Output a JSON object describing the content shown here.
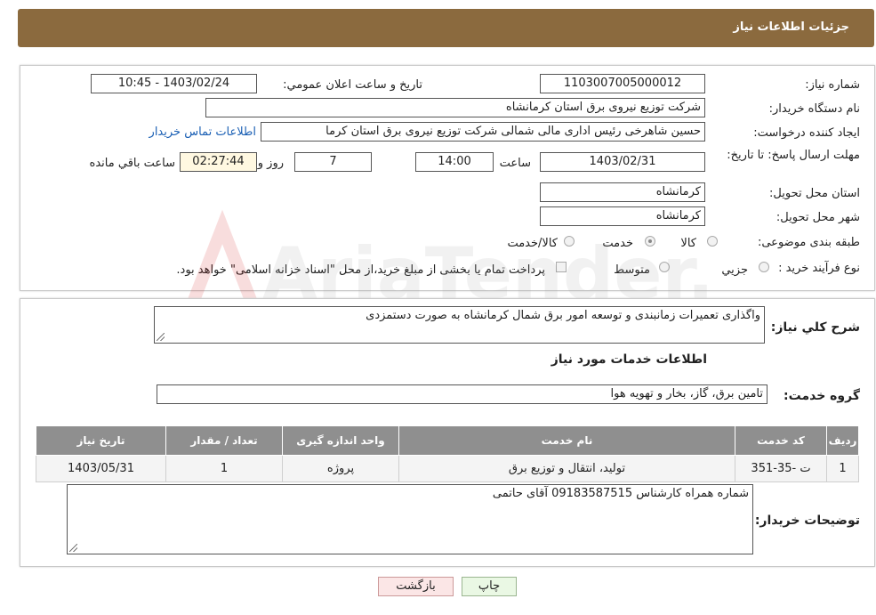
{
  "header": {
    "title": "جزئیات اطلاعات نیاز"
  },
  "form": {
    "need_number": {
      "label": "شماره نیاز:",
      "value": "1103007005000012"
    },
    "announce_datetime": {
      "label": "تاریخ و ساعت اعلان عمومي:",
      "value": "1403/02/24 - 10:45"
    },
    "buyer_org": {
      "label": "نام دستگاه خريدار:",
      "value": "شرکت توزیع نیروی برق استان کرمانشاه"
    },
    "requester": {
      "label": "ايجاد کننده درخواست:",
      "value": "حسین شاهرخی رئیس اداری مالی شمالی شرکت توزیع نیروی برق استان کرما",
      "contact_link": "اطلاعات تماس خريدار"
    },
    "deadline": {
      "label": "مهلت ارسال پاسخ: تا تاريخ:",
      "date": "1403/02/31",
      "time_label": "ساعت",
      "time": "14:00",
      "days": "7",
      "days_label": "روز و",
      "remaining": "02:27:44",
      "remaining_label": "ساعت باقي مانده"
    },
    "delivery_province": {
      "label": "استان محل تحويل:",
      "value": "کرمانشاه"
    },
    "delivery_city": {
      "label": "شهر محل تحويل:",
      "value": "کرمانشاه"
    },
    "category": {
      "label": "طبقه بندی موضوعی:",
      "options": [
        {
          "label": "کالا",
          "checked": false
        },
        {
          "label": "خدمت",
          "checked": true
        },
        {
          "label": "کالا/خدمت",
          "checked": false
        }
      ]
    },
    "purchase_type": {
      "label": "نوع فرآیند خرید :",
      "options": [
        {
          "label": "جزیي",
          "checked": false
        },
        {
          "label": "متوسط",
          "checked": false
        }
      ],
      "note": "پرداخت تمام یا بخشی از مبلغ خرید،از محل \"اسناد خزانه اسلامی\" خواهد بود."
    }
  },
  "details": {
    "general_desc": {
      "label": "شرح کلي نياز:",
      "value": "واگذاری تعمیرات زمانبندی و توسعه امور برق شمال کرمانشاه به صورت دستمزدی"
    },
    "services_title": "اطلاعات خدمات مورد نياز",
    "service_group": {
      "label": "گروه خدمت:",
      "value": "تامین برق، گاز، بخار و تهویه هوا"
    },
    "table": {
      "headers": [
        "رديف",
        "کد خدمت",
        "نام خدمت",
        "واحد اندازه گيری",
        "تعداد / مقدار",
        "تاريخ نياز"
      ],
      "rows": [
        [
          "1",
          "ت -35-351",
          "تولید، انتقال و توزیع برق",
          "پروژه",
          "1",
          "1403/05/31"
        ]
      ]
    },
    "buyer_notes": {
      "label": "توضيحات خريدار:",
      "value": "شماره همراه کارشناس 09183587515 آقای حاتمی"
    }
  },
  "buttons": {
    "print": "چاپ",
    "back": "بازگشت"
  },
  "watermark": {
    "text": "AriaTender.net"
  },
  "colors": {
    "header_bg": "#8b6a3e",
    "table_header_bg": "#8f8f8f",
    "link": "#1a5fb4"
  }
}
